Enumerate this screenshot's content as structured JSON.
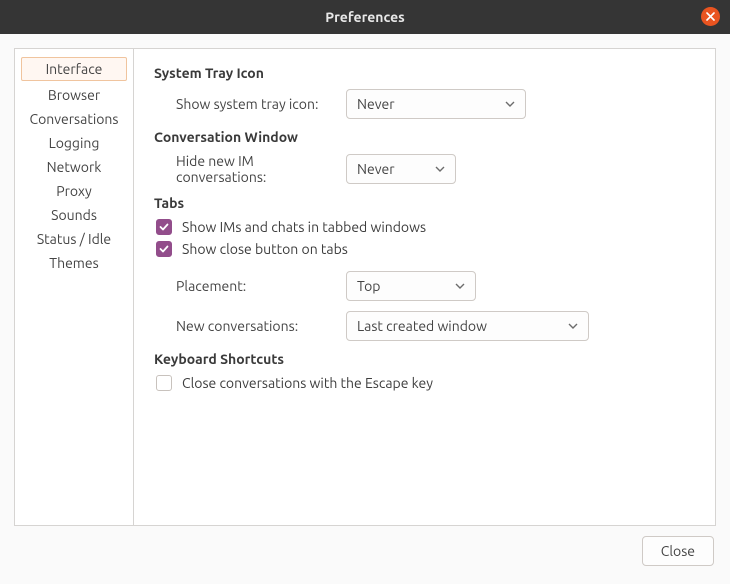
{
  "window": {
    "title": "Preferences"
  },
  "sidebar": {
    "items": [
      {
        "label": "Interface",
        "selected": true
      },
      {
        "label": "Browser",
        "selected": false
      },
      {
        "label": "Conversations",
        "selected": false
      },
      {
        "label": "Logging",
        "selected": false
      },
      {
        "label": "Network",
        "selected": false
      },
      {
        "label": "Proxy",
        "selected": false
      },
      {
        "label": "Sounds",
        "selected": false
      },
      {
        "label": "Status / Idle",
        "selected": false
      },
      {
        "label": "Themes",
        "selected": false
      }
    ]
  },
  "sections": {
    "tray": {
      "title": "System Tray Icon",
      "show_label": "Show system tray icon:",
      "show_value": "Never"
    },
    "convo": {
      "title": "Conversation Window",
      "hide_label": "Hide new IM conversations:",
      "hide_value": "Never"
    },
    "tabs": {
      "title": "Tabs",
      "cb1_label": "Show IMs and chats in tabbed windows",
      "cb1_checked": true,
      "cb2_label": "Show close button on tabs",
      "cb2_checked": true,
      "placement_label": "Placement:",
      "placement_value": "Top",
      "newconv_label": "New conversations:",
      "newconv_value": "Last created window"
    },
    "keys": {
      "title": "Keyboard Shortcuts",
      "cb_label": "Close conversations with the Escape key",
      "cb_checked": false
    }
  },
  "footer": {
    "close_label": "Close"
  }
}
